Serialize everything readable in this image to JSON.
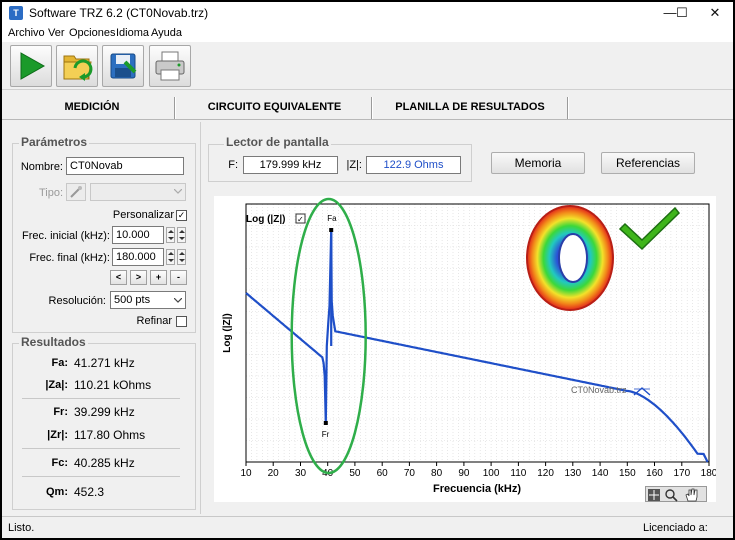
{
  "window": {
    "title": "Software TRZ 6.2 (CT0Novab.trz)",
    "icon_text": "T",
    "minimize": "—",
    "maximize": "☐",
    "close": "✕"
  },
  "menu": [
    "Archivo",
    "Ver",
    "Opciones",
    "Idioma",
    "Ayuda"
  ],
  "toolbar": [
    {
      "name": "play-icon"
    },
    {
      "name": "open-folder-icon"
    },
    {
      "name": "save-icon"
    },
    {
      "name": "print-icon"
    }
  ],
  "tabs": [
    "MEDICIÓN",
    "CIRCUITO EQUIVALENTE",
    "PLANILLA DE RESULTADOS"
  ],
  "parametros": {
    "title": "Parámetros",
    "nombre_label": "Nombre:",
    "nombre_value": "CT0Novab",
    "tipo_label": "Tipo:",
    "personalizar_label": "Personalizar",
    "personalizar_checked": "✓",
    "frec_inicial_label": "Frec. inicial (kHz):",
    "frec_inicial_value": "10.000",
    "frec_final_label": "Frec. final (kHz):",
    "frec_final_value": "180.000",
    "nav_buttons": [
      "<",
      ">",
      "+",
      "-"
    ],
    "resolucion_label": "Resolución:",
    "resolucion_value": "500 pts",
    "refinar_label": "Refinar"
  },
  "resultados": {
    "title": "Resultados",
    "items": [
      {
        "label": "Fa:",
        "value": "41.271 kHz"
      },
      {
        "label": "|Za|:",
        "value": "110.21 kOhms"
      },
      {
        "label": "Fr:",
        "value": "39.299 kHz"
      },
      {
        "label": "|Zr|:",
        "value": "117.80 Ohms"
      },
      {
        "label": "Fc:",
        "value": "40.285 kHz"
      },
      {
        "label": "Qm:",
        "value": "452.3"
      }
    ]
  },
  "lector": {
    "title": "Lector de pantalla",
    "f_label": "F:",
    "f_value": "179.999 kHz",
    "z_label": "|Z|:",
    "z_value": "122.9 Ohms"
  },
  "buttons": {
    "memoria": "Memoria",
    "referencias": "Referencias"
  },
  "plot": {
    "log_label": "Log (|Z|)",
    "log_checked": "✓",
    "ylabel": "Log (|Z|)",
    "xlabel": "Frecuencia (kHz)",
    "xticks": [
      10,
      20,
      30,
      40,
      50,
      60,
      70,
      80,
      90,
      100,
      110,
      120,
      130,
      140,
      150,
      160,
      170,
      180
    ],
    "xlim": [
      10,
      180
    ],
    "fa_marker": "Fa",
    "fr_marker": "Fr",
    "fa_khz": 41.271,
    "fr_khz": 39.299,
    "curve_file_label": "CT0Novab.trz",
    "curve_color": "#1f4fc8",
    "highlight_color": "#2fae4a",
    "check_color": "#3fb51b"
  },
  "status": {
    "left": "Listo.",
    "right": "Licenciado a:"
  }
}
